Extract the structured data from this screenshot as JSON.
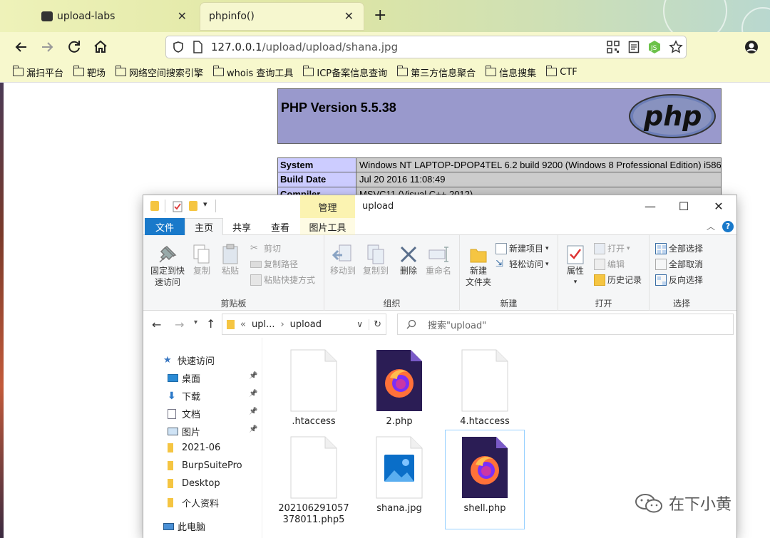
{
  "browser": {
    "tabs": [
      {
        "label": "upload-labs",
        "active": false
      },
      {
        "label": "phpinfo()",
        "active": true
      }
    ],
    "new_tab_label": "+",
    "url_host": "127.0.0.1",
    "url_path": "/upload/upload/shana.jpg",
    "bookmarks": [
      "漏扫平台",
      "靶场",
      "网络空间搜索引擎",
      "whois 查询工具",
      "ICP备案信息查询",
      "第三方信息聚合",
      "信息搜集",
      "CTF"
    ],
    "icons": [
      "back-icon",
      "forward-icon",
      "reload-icon",
      "home-icon",
      "shield-icon",
      "page-icon",
      "qr-icon",
      "reader-icon",
      "node-icon",
      "star-icon",
      "account-icon"
    ]
  },
  "phpinfo": {
    "version": "PHP Version 5.5.38",
    "logo_text": "php",
    "rows": [
      {
        "key": "System",
        "value": "Windows NT LAPTOP-DPOP4TEL 6.2 build 9200 (Windows 8 Professional Edition) i586"
      },
      {
        "key": "Build Date",
        "value": "Jul 20 2016 11:08:49"
      },
      {
        "key": "Compiler",
        "value": "MSVC11 (Visual C++ 2012)"
      }
    ]
  },
  "explorer": {
    "context_tab": "管理",
    "title": "upload",
    "window_controls": {
      "min": "—",
      "max": "☐",
      "close": "✕"
    },
    "tabs": {
      "file": "文件",
      "home": "主页",
      "share": "共享",
      "view": "查看",
      "picture_tools": "图片工具"
    },
    "clipboard": {
      "pin": "固定到快\n速访问",
      "copy": "复制",
      "paste": "粘贴",
      "cut": "剪切",
      "copy_path": "复制路径",
      "paste_shortcut": "粘贴快捷方式",
      "label": "剪贴板"
    },
    "organize": {
      "move_to": "移动到",
      "copy_to": "复制到",
      "delete": "删除",
      "rename": "重命名",
      "label": "组织"
    },
    "new": {
      "new_folder": "新建\n文件夹",
      "new_item": "新建项目",
      "easy_access": "轻松访问",
      "label": "新建"
    },
    "open": {
      "properties": "属性",
      "open": "打开",
      "edit": "编辑",
      "history": "历史记录",
      "label": "打开"
    },
    "select": {
      "select_all": "全部选择",
      "select_none": "全部取消",
      "invert": "反向选择",
      "label": "选择"
    },
    "breadcrumb": {
      "prefix": "«",
      "parent": "upl...",
      "current": "upload"
    },
    "search_placeholder": "搜索\"upload\"",
    "nav": [
      {
        "label": "快速访问",
        "icon": "star-icon",
        "pinned": false
      },
      {
        "label": "桌面",
        "icon": "desktop-icon",
        "pinned": true
      },
      {
        "label": "下载",
        "icon": "download-icon",
        "pinned": true
      },
      {
        "label": "文档",
        "icon": "documents-icon",
        "pinned": true
      },
      {
        "label": "图片",
        "icon": "pictures-icon",
        "pinned": true
      },
      {
        "label": "2021-06",
        "icon": "folder-icon",
        "pinned": false
      },
      {
        "label": "BurpSuitePro",
        "icon": "folder-icon",
        "pinned": false
      },
      {
        "label": "Desktop",
        "icon": "folder-icon",
        "pinned": false
      },
      {
        "label": "个人资料",
        "icon": "folder-icon",
        "pinned": false
      },
      {
        "label": "此电脑",
        "icon": "pc-icon",
        "pinned": false
      }
    ],
    "files": [
      {
        "name": ".htaccess",
        "type": "blank"
      },
      {
        "name": "2.php",
        "type": "firefox"
      },
      {
        "name": "4.htaccess",
        "type": "blank"
      },
      {
        "name": "202106291057378011.php5",
        "line1": "202106291057",
        "line2": "378011.php5",
        "type": "blank"
      },
      {
        "name": "shana.jpg",
        "type": "image"
      },
      {
        "name": "shell.php",
        "type": "firefox",
        "selected": true
      }
    ]
  },
  "watermark": "在下小黄",
  "colors": {
    "php_header": "#9999cc",
    "php_key": "#ccccff",
    "php_value": "#cccccc",
    "ribbon_file_tab": "#1979ca",
    "context_tab": "#fbf3b1"
  }
}
